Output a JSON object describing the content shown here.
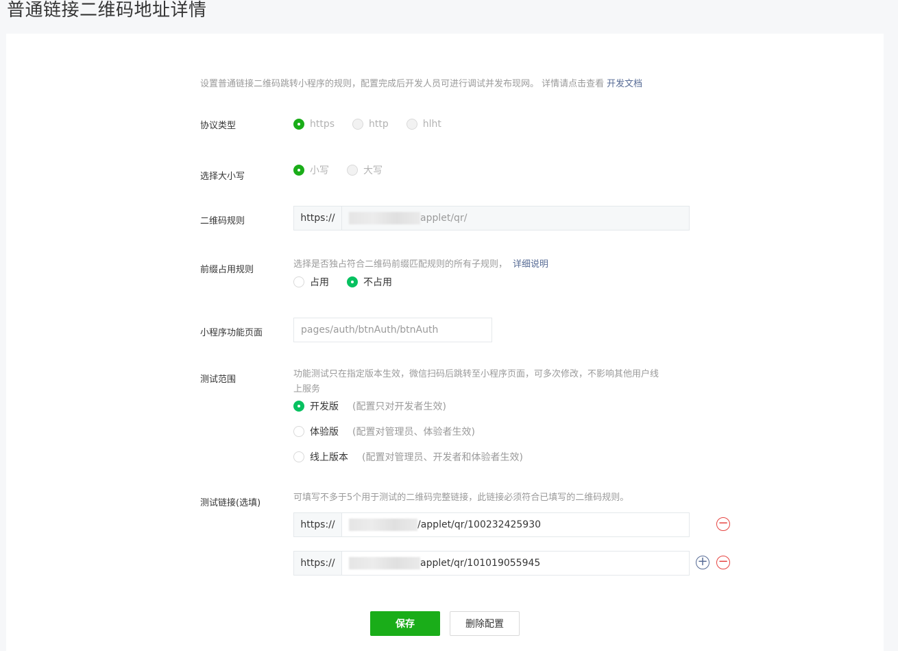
{
  "page": {
    "title": "普通链接二维码地址详情"
  },
  "intro": {
    "text": "设置普通链接二维码跳转小程序的规则，配置完成后开发人员可进行调试并发布现网。 详情请点击查看",
    "link": "开发文档"
  },
  "protocol": {
    "label": "协议类型",
    "options": [
      "https",
      "http",
      "hlht"
    ],
    "selected": "https"
  },
  "case": {
    "label": "选择大小写",
    "options": [
      "小写",
      "大写"
    ],
    "selected": "小写"
  },
  "qr_rule": {
    "label": "二维码规则",
    "prefix": "https://",
    "value": "applet/qr/"
  },
  "prefix_rule": {
    "label": "前缀占用规则",
    "hint": "选择是否独占符合二维码前缀匹配规则的所有子规则，",
    "hint_link": "详细说明",
    "options": [
      "占用",
      "不占用"
    ],
    "selected": "不占用"
  },
  "page_path": {
    "label": "小程序功能页面",
    "value": "pages/auth/btnAuth/btnAuth"
  },
  "test_scope": {
    "label": "测试范围",
    "hint_line1": "功能测试只在指定版本生效，微信扫码后跳转至小程序页面，可多次修改，不影响其他用户线",
    "hint_line2": "上服务",
    "options": [
      {
        "label": "开发版",
        "note": "(配置只对开发者生效)"
      },
      {
        "label": "体验版",
        "note": "(配置对管理员、体验者生效)"
      },
      {
        "label": "线上版本",
        "note": "(配置对管理员、开发者和体验者生效)"
      }
    ],
    "selected": "开发版"
  },
  "test_links": {
    "label": "测试链接(选填)",
    "hint": "可填写不多于5个用于测试的二维码完整链接，此链接必须符合已填写的二维码规则。",
    "prefix": "https://",
    "links": [
      {
        "value": "/applet/qr/100232425930"
      },
      {
        "value": "applet/qr/101019055945"
      }
    ]
  },
  "actions": {
    "save": "保存",
    "delete": "删除配置"
  },
  "colors": {
    "primary": "#1aad19",
    "radio_checked": "#07c160",
    "link": "#576b95",
    "danger": "#e64340"
  }
}
